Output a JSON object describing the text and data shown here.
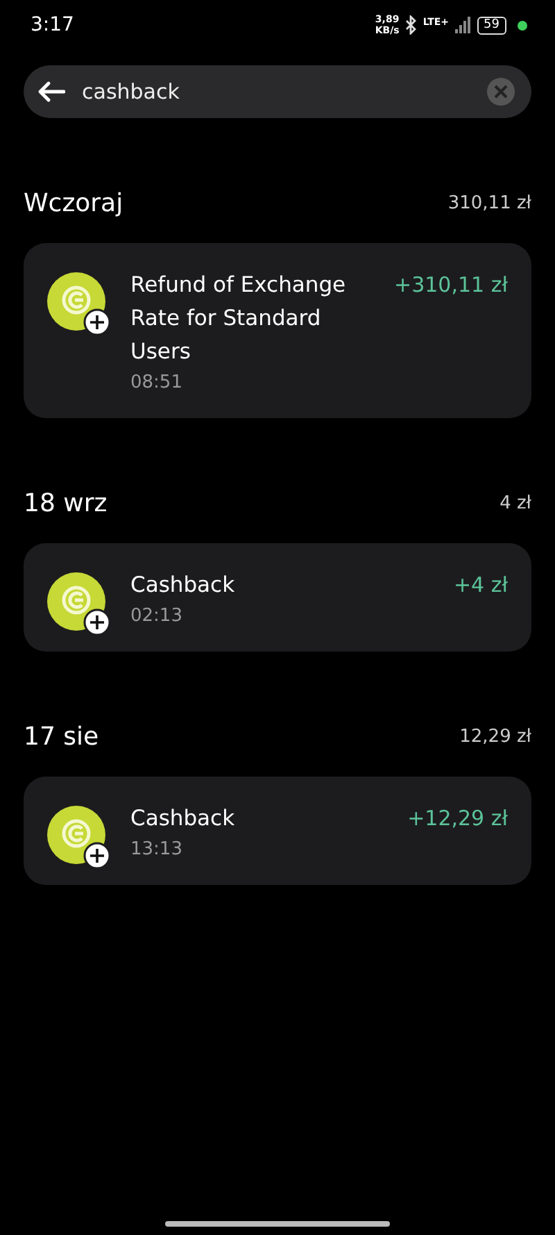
{
  "status_bar": {
    "time": "3:17",
    "speed_value": "3,89",
    "speed_unit": "KB/s",
    "network": "LTE+",
    "battery": "59"
  },
  "search": {
    "value": "cashback"
  },
  "groups": [
    {
      "date": "Wczoraj",
      "total": "310,11 zł",
      "transactions": [
        {
          "title": "Refund of Exchange Rate for Standard Users",
          "time": "08:51",
          "amount": "+310,11 zł"
        }
      ]
    },
    {
      "date": "18 wrz",
      "total": "4 zł",
      "transactions": [
        {
          "title": "Cashback",
          "time": "02:13",
          "amount": "+4 zł"
        }
      ]
    },
    {
      "date": "17 sie",
      "total": "12,29 zł",
      "transactions": [
        {
          "title": "Cashback",
          "time": "13:13",
          "amount": "+12,29 zł"
        }
      ]
    }
  ]
}
